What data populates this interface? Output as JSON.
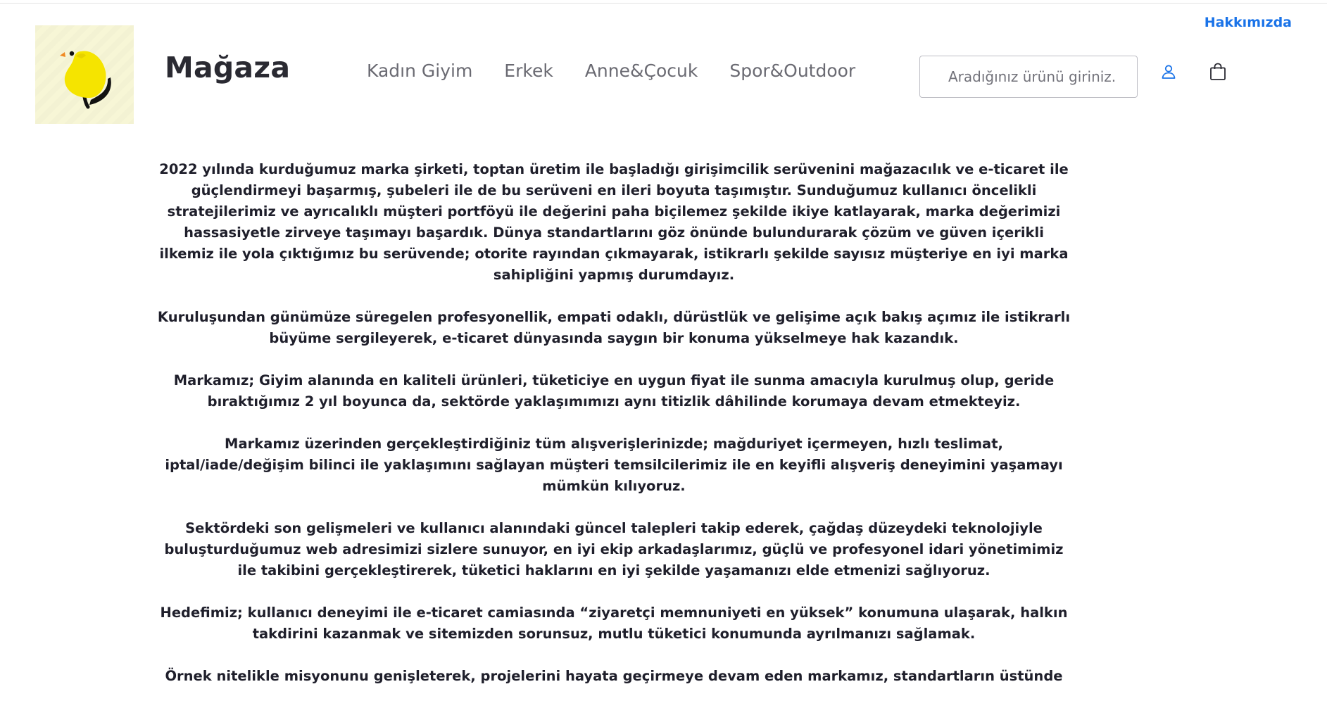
{
  "header": {
    "about_link": "Hakkımızda",
    "brand": "Mağaza",
    "logo_icon": "bird-logo-icon",
    "nav": [
      {
        "label": "Kadın Giyim"
      },
      {
        "label": "Erkek"
      },
      {
        "label": "Anne&Çocuk"
      },
      {
        "label": "Spor&Outdoor"
      }
    ],
    "search": {
      "placeholder": "Aradığınız ürünü giriniz.",
      "value": ""
    },
    "icons": {
      "user": "user-icon",
      "cart": "shopping-bag-icon"
    },
    "colors": {
      "accent": "#1a73e8",
      "logo_bg": "#f7f6d6",
      "bird": "#f5e400"
    }
  },
  "main": {
    "paragraphs": [
      "2022 yılında kurduğumuz marka şirketi, toptan üretim ile başladığı girişimcilik serüvenini mağazacılık ve e-ticaret ile güçlendirmeyi başarmış, şubeleri ile de bu serüveni en ileri boyuta taşımıştır. Sunduğumuz kullanıcı öncelikli stratejilerimiz ve ayrıcalıklı müşteri portföyü ile değerini paha biçilemez şekilde ikiye katlayarak, marka değerimizi hassasiyetle zirveye taşımayı başardık. Dünya standartlarını göz önünde bulundurarak çözüm ve güven içerikli ilkemiz ile yola çıktığımız bu serüvende; otorite rayından çıkmayarak, istikrarlı şekilde sayısız müşteriye en iyi marka sahipliğini yapmış durumdayız.",
      "Kuruluşundan günümüze süregelen profesyonellik, empati odaklı, dürüstlük ve gelişime açık bakış açımız ile istikrarlı büyüme sergileyerek, e-ticaret dünyasında saygın bir konuma yükselmeye hak kazandık.",
      "Markamız; Giyim alanında en kaliteli ürünleri, tüketiciye en uygun fiyat ile sunma amacıyla kurulmuş olup, geride bıraktığımız 2 yıl boyunca da, sektörde yaklaşımımızı aynı titizlik dâhilinde korumaya devam etmekteyiz.",
      "Markamız üzerinden gerçekleştirdiğiniz tüm alışverişlerinizde; mağduriyet içermeyen, hızlı teslimat, iptal/iade/değişim bilinci ile yaklaşımını sağlayan müşteri temsilcilerimiz ile en keyifli alışveriş deneyimini yaşamayı mümkün kılıyoruz.",
      "Sektördeki son gelişmeleri ve kullanıcı alanındaki güncel talepleri takip ederek, çağdaş düzeydeki teknolojiyle buluşturduğumuz web adresimizi sizlere sunuyor, en iyi ekip arkadaşlarımız, güçlü ve profesyonel idari yönetimimiz ile takibini gerçekleştirerek, tüketici haklarını en iyi şekilde yaşamanızı elde etmenizi sağlıyoruz.",
      "Hedefimiz; kullanıcı deneyimi ile e-ticaret camiasında “ziyaretçi memnuniyeti en yüksek” konumuna ulaşarak, halkın takdirini kazanmak ve sitemizden sorunsuz, mutlu tüketici konumunda ayrılmanızı sağlamak.",
      "Örnek nitelikle misyonunu genişleterek, projelerini hayata geçirmeye devam eden markamız, standartların üstünde"
    ]
  }
}
